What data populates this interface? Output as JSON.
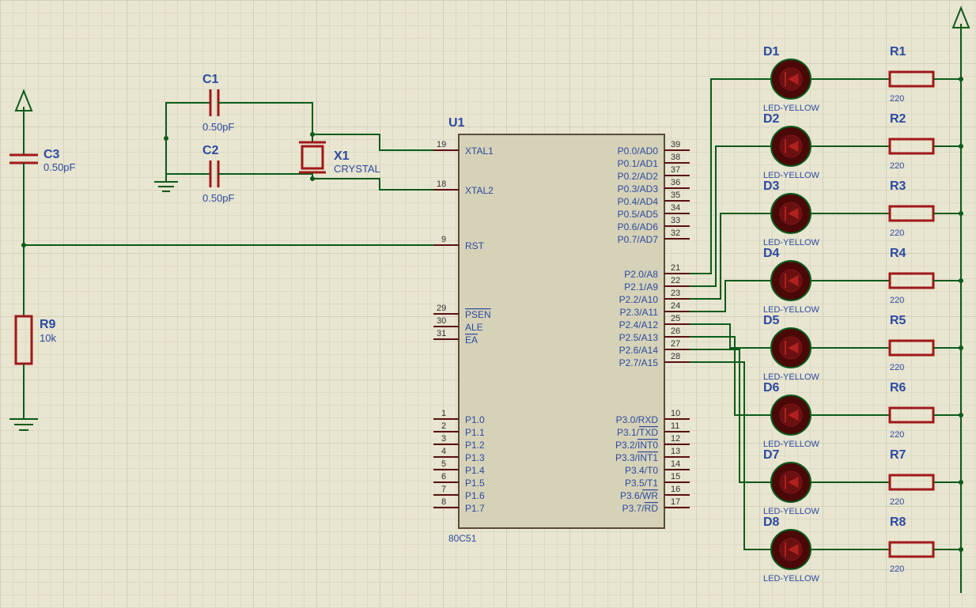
{
  "ic": {
    "ref": "U1",
    "part": "80C51",
    "left_pins": [
      {
        "num": "19",
        "name": "XTAL1"
      },
      {
        "num": "18",
        "name": "XTAL2"
      },
      {
        "num": "9",
        "name": "RST"
      },
      {
        "num": "29",
        "name": "PSEN",
        "over": true
      },
      {
        "num": "30",
        "name": "ALE"
      },
      {
        "num": "31",
        "name": "EA",
        "over": true
      },
      {
        "num": "1",
        "name": "P1.0"
      },
      {
        "num": "2",
        "name": "P1.1"
      },
      {
        "num": "3",
        "name": "P1.2"
      },
      {
        "num": "4",
        "name": "P1.3"
      },
      {
        "num": "5",
        "name": "P1.4"
      },
      {
        "num": "6",
        "name": "P1.5"
      },
      {
        "num": "7",
        "name": "P1.6"
      },
      {
        "num": "8",
        "name": "P1.7"
      }
    ],
    "right_pins": [
      {
        "num": "39",
        "name": "P0.0/AD0"
      },
      {
        "num": "38",
        "name": "P0.1/AD1"
      },
      {
        "num": "37",
        "name": "P0.2/AD2"
      },
      {
        "num": "36",
        "name": "P0.3/AD3"
      },
      {
        "num": "35",
        "name": "P0.4/AD4"
      },
      {
        "num": "34",
        "name": "P0.5/AD5"
      },
      {
        "num": "33",
        "name": "P0.6/AD6"
      },
      {
        "num": "32",
        "name": "P0.7/AD7"
      },
      {
        "num": "21",
        "name": "P2.0/A8"
      },
      {
        "num": "22",
        "name": "P2.1/A9"
      },
      {
        "num": "23",
        "name": "P2.2/A10"
      },
      {
        "num": "24",
        "name": "P2.3/A11"
      },
      {
        "num": "25",
        "name": "P2.4/A12"
      },
      {
        "num": "26",
        "name": "P2.5/A13"
      },
      {
        "num": "27",
        "name": "P2.6/A14"
      },
      {
        "num": "28",
        "name": "P2.7/A15"
      },
      {
        "num": "10",
        "name": "P3.0/RXD"
      },
      {
        "num": "11",
        "name": "P3.1/TXD",
        "over_part": "TXD"
      },
      {
        "num": "12",
        "name": "P3.2/INT0",
        "over_part": "INT0"
      },
      {
        "num": "13",
        "name": "P3.3/INT1",
        "over_part": "INT1"
      },
      {
        "num": "14",
        "name": "P3.4/T0"
      },
      {
        "num": "15",
        "name": "P3.5/T1"
      },
      {
        "num": "16",
        "name": "P3.6/WR",
        "over_part": "WR"
      },
      {
        "num": "17",
        "name": "P3.7/RD",
        "over_part": "RD"
      }
    ]
  },
  "caps": {
    "c1": {
      "ref": "C1",
      "val": "0.50pF"
    },
    "c2": {
      "ref": "C2",
      "val": "0.50pF"
    },
    "c3": {
      "ref": "C3",
      "val": "0.50pF"
    }
  },
  "crystal": {
    "ref": "X1",
    "val": "CRYSTAL"
  },
  "r9": {
    "ref": "R9",
    "val": "10k"
  },
  "leds": [
    {
      "d": "D1",
      "dval": "LED-YELLOW",
      "r": "R1",
      "rval": "220"
    },
    {
      "d": "D2",
      "dval": "LED-YELLOW",
      "r": "R2",
      "rval": "220"
    },
    {
      "d": "D3",
      "dval": "LED-YELLOW",
      "r": "R3",
      "rval": "220"
    },
    {
      "d": "D4",
      "dval": "LED-YELLOW",
      "r": "R4",
      "rval": "220"
    },
    {
      "d": "D5",
      "dval": "LED-YELLOW",
      "r": "R5",
      "rval": "220"
    },
    {
      "d": "D6",
      "dval": "LED-YELLOW",
      "r": "R6",
      "rval": "220"
    },
    {
      "d": "D7",
      "dval": "LED-YELLOW",
      "r": "R7",
      "rval": "220"
    },
    {
      "d": "D8",
      "dval": "LED-YELLOW",
      "r": "R8",
      "rval": "220"
    }
  ]
}
